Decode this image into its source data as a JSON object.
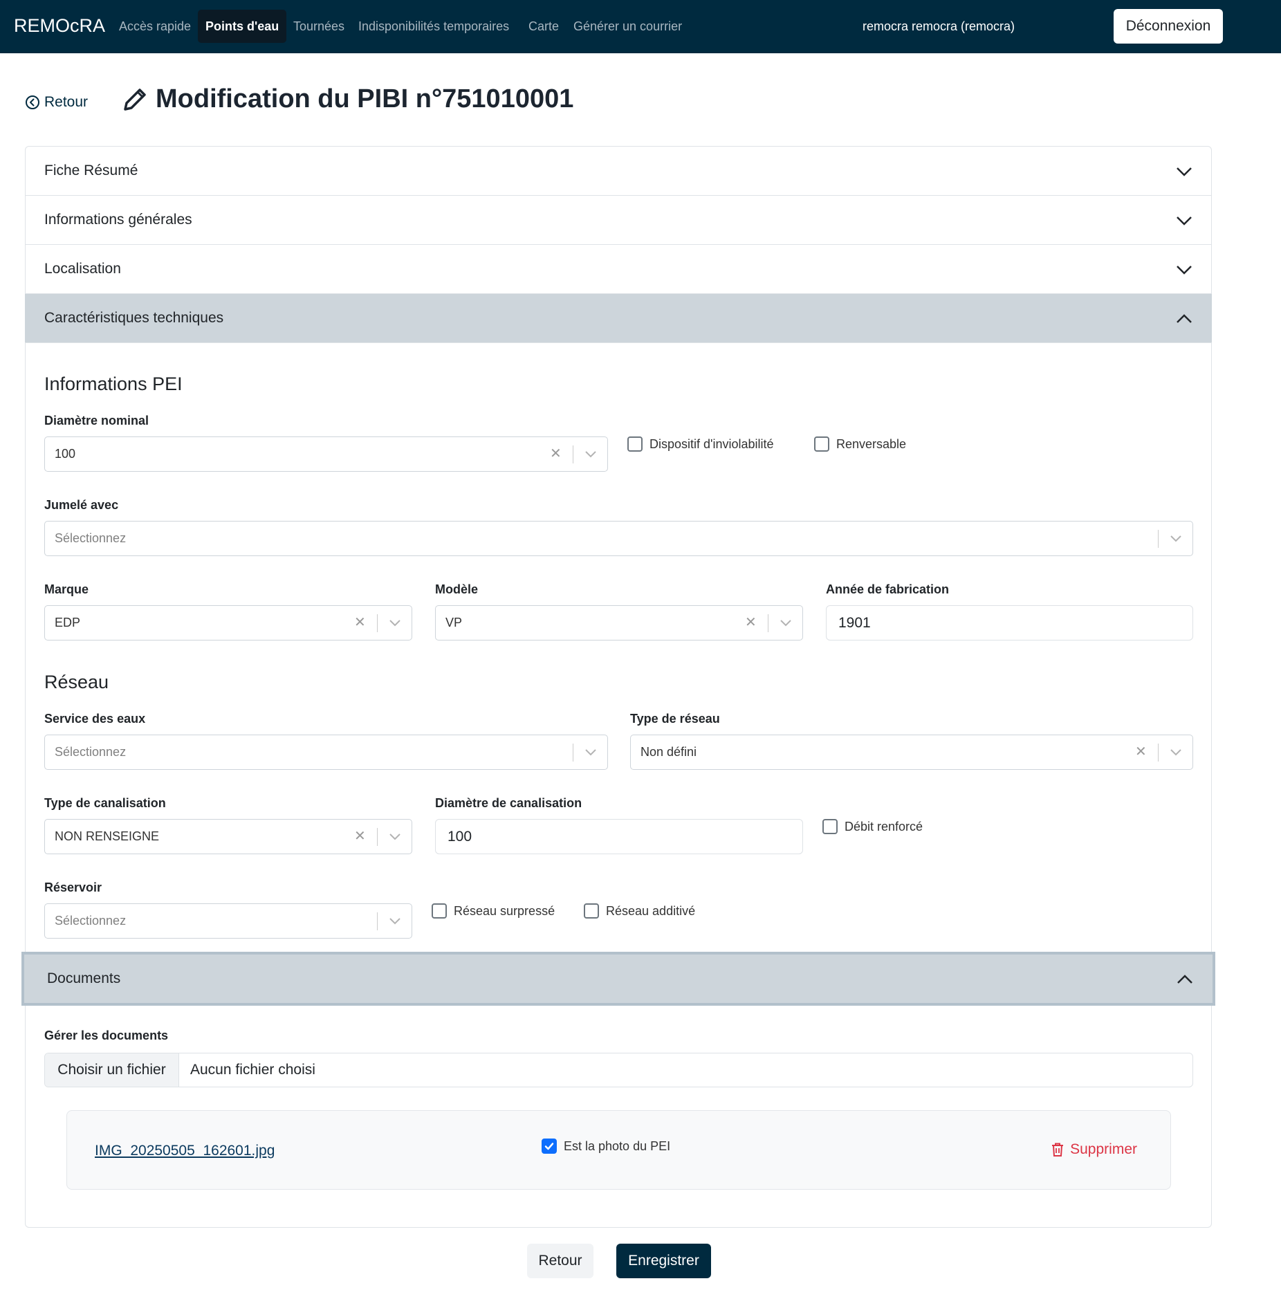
{
  "nav": {
    "brand": "REMOcRA",
    "items": [
      "Accès rapide",
      "Points d'eau",
      "Tournées",
      "Indisponibilités temporaires",
      "Carte",
      "Générer un courrier"
    ],
    "user": "remocra remocra (remocra)",
    "logout": "Déconnexion"
  },
  "header": {
    "back": "Retour",
    "title": "Modification du PIBI n°751010001"
  },
  "accordion": {
    "fiche": "Fiche Résumé",
    "infos": "Informations générales",
    "localisation": "Localisation",
    "caracteristiques": "Caractéristiques techniques",
    "documents": "Documents"
  },
  "pei": {
    "heading": "Informations PEI",
    "diametre_label": "Diamètre nominal",
    "diametre_value": "100",
    "inviolabilite": "Dispositif d'inviolabilité",
    "renversable": "Renversable",
    "jumele_label": "Jumelé avec",
    "jumele_placeholder": "Sélectionnez",
    "marque_label": "Marque",
    "marque_value": "EDP",
    "modele_label": "Modèle",
    "modele_value": "VP",
    "annee_label": "Année de fabrication",
    "annee_value": "1901"
  },
  "reseau": {
    "heading": "Réseau",
    "service_label": "Service des eaux",
    "service_placeholder": "Sélectionnez",
    "type_reseau_label": "Type de réseau",
    "type_reseau_value": "Non défini",
    "canalisation_label": "Type de canalisation",
    "canalisation_value": "NON RENSEIGNE",
    "diametre_canal_label": "Diamètre de canalisation",
    "diametre_canal_value": "100",
    "debit_renforce": "Débit renforcé",
    "reservoir_label": "Réservoir",
    "reservoir_placeholder": "Sélectionnez",
    "surpresse": "Réseau surpressé",
    "additive": "Réseau additivé"
  },
  "documents": {
    "label": "Gérer les documents",
    "file_button": "Choisir un fichier",
    "file_status": "Aucun fichier choisi",
    "doc_name": "IMG_20250505_162601.jpg",
    "photo_label": "Est la photo du PEI",
    "delete": "Supprimer"
  },
  "footer": {
    "back": "Retour",
    "save": "Enregistrer"
  }
}
